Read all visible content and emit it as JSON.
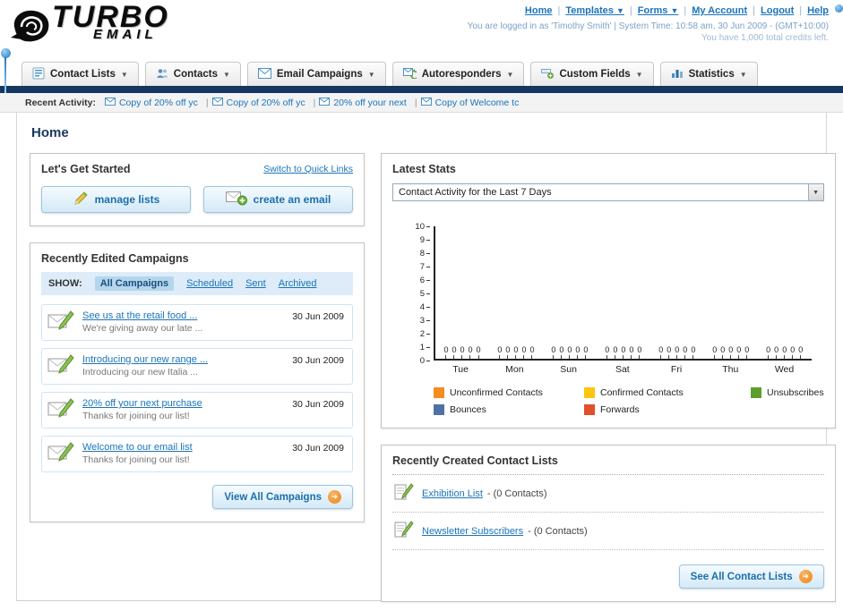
{
  "icons": {
    "dropdown_arrow": "▼",
    "select_arrow": "▼",
    "forward_arrow": "➜"
  },
  "header": {
    "logo_primary": "TURBO",
    "logo_secondary": "EMAIL",
    "nav_links": [
      "Home",
      "Templates",
      "Forms",
      "My Account",
      "Logout",
      "Help"
    ],
    "login_info": "You are logged in as 'Timothy Smith' | System Time: 10:58 am, 30 Jun 2009 - (GMT+10:00)",
    "credits": "You have 1,000 total credits left."
  },
  "nav_tabs": [
    {
      "label": "Contact Lists"
    },
    {
      "label": "Contacts"
    },
    {
      "label": "Email Campaigns"
    },
    {
      "label": "Autoresponders"
    },
    {
      "label": "Custom Fields"
    },
    {
      "label": "Statistics"
    }
  ],
  "recent_activity": {
    "label": "Recent Activity:",
    "items": [
      "Copy of 20% off yc",
      "Copy of 20% off yc",
      "20% off your next",
      "Copy of Welcome tc"
    ]
  },
  "page_title": "Home",
  "get_started": {
    "title": "Let's Get Started",
    "switch_link": "Switch to Quick Links",
    "buttons": [
      {
        "label": "manage lists"
      },
      {
        "label": "create an email"
      }
    ]
  },
  "campaigns": {
    "title": "Recently Edited Campaigns",
    "show_label": "SHOW:",
    "tabs": [
      "All Campaigns",
      "Scheduled",
      "Sent",
      "Archived"
    ],
    "active_tab": "All Campaigns",
    "items": [
      {
        "title": "See us at the retail food ...",
        "subtitle": "We're giving away our late ...",
        "date": "30 Jun 2009"
      },
      {
        "title": "Introducing our new range ...",
        "subtitle": "Introducing our new Italia ...",
        "date": "30 Jun 2009"
      },
      {
        "title": "20% off your next purchase",
        "subtitle": "Thanks for joining our list!",
        "date": "30 Jun 2009"
      },
      {
        "title": "Welcome to our email list",
        "subtitle": "Thanks for joining our list!",
        "date": "30 Jun 2009"
      }
    ],
    "view_all_label": "View All Campaigns"
  },
  "stats": {
    "title": "Latest Stats",
    "dropdown_value": "Contact Activity for the Last 7 Days",
    "chart_data": {
      "type": "bar",
      "categories": [
        "Tue",
        "Mon",
        "Sun",
        "Sat",
        "Fri",
        "Thu",
        "Wed"
      ],
      "series": [
        {
          "name": "Unconfirmed Contacts",
          "color": "#f68b1f",
          "values": [
            0,
            0,
            0,
            0,
            0,
            0,
            0
          ]
        },
        {
          "name": "Confirmed Contacts",
          "color": "#fdc50f",
          "values": [
            0,
            0,
            0,
            0,
            0,
            0,
            0
          ]
        },
        {
          "name": "Unsubscribes",
          "color": "#5b9e2d",
          "values": [
            0,
            0,
            0,
            0,
            0,
            0,
            0
          ]
        },
        {
          "name": "Bounces",
          "color": "#4f72a6",
          "values": [
            0,
            0,
            0,
            0,
            0,
            0,
            0
          ]
        },
        {
          "name": "Forwards",
          "color": "#e0502a",
          "values": [
            0,
            0,
            0,
            0,
            0,
            0,
            0
          ]
        }
      ],
      "ylim": [
        0,
        10
      ],
      "yticks": [
        0,
        1,
        2,
        3,
        4,
        5,
        6,
        7,
        8,
        9,
        10
      ],
      "legend_position": "bottom",
      "grid": false
    }
  },
  "contact_lists": {
    "title": "Recently Created Contact Lists",
    "items": [
      {
        "name": "Exhibition List",
        "detail": "- (0 Contacts)"
      },
      {
        "name": "Newsletter Subscribers",
        "detail": "- (0 Contacts)"
      }
    ],
    "see_all_label": "See All Contact Lists"
  }
}
